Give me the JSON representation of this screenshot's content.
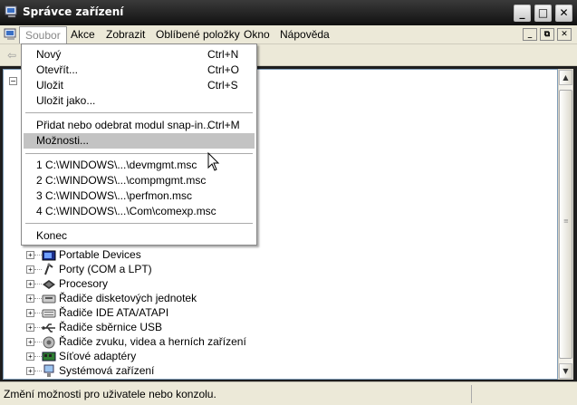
{
  "window": {
    "title": "Správce zařízení",
    "buttons": {
      "minimize": "_",
      "maximize": "□",
      "close": "✕"
    }
  },
  "menubar": {
    "items": [
      "Soubor",
      "Akce",
      "Zobrazit",
      "Oblíbené položky",
      "Okno",
      "Nápověda"
    ],
    "mdi_buttons": [
      "_",
      "⧉",
      "✕"
    ]
  },
  "toolbar": {
    "back_icon": "back-arrow-icon",
    "back_glyph": "⇦"
  },
  "file_menu": {
    "items": [
      {
        "label": "Nový",
        "shortcut": "Ctrl+N"
      },
      {
        "label": "Otevřít...",
        "shortcut": "Ctrl+O"
      },
      {
        "label": "Uložit",
        "shortcut": "Ctrl+S"
      },
      {
        "label": "Uložit jako...",
        "shortcut": ""
      },
      {
        "label": "Přidat nebo odebrat modul snap-in...",
        "shortcut": "Ctrl+M"
      },
      {
        "label": "Možnosti...",
        "shortcut": ""
      },
      {
        "label": "1 C:\\WINDOWS\\...\\devmgmt.msc",
        "shortcut": ""
      },
      {
        "label": "2 C:\\WINDOWS\\...\\compmgmt.msc",
        "shortcut": ""
      },
      {
        "label": "3 C:\\WINDOWS\\...\\perfmon.msc",
        "shortcut": ""
      },
      {
        "label": "4 C:\\WINDOWS\\...\\Com\\comexp.msc",
        "shortcut": ""
      },
      {
        "label": "Konec",
        "shortcut": ""
      }
    ],
    "highlighted": "Možnosti..."
  },
  "tree": {
    "root_toggle": "−",
    "items": [
      {
        "label": "Portable Devices",
        "icon": "portable-device-icon"
      },
      {
        "label": "Porty (COM a LPT)",
        "icon": "port-icon"
      },
      {
        "label": "Procesory",
        "icon": "processor-icon"
      },
      {
        "label": "Řadiče disketových jednotek",
        "icon": "floppy-controller-icon"
      },
      {
        "label": "Řadiče IDE ATA/ATAPI",
        "icon": "ide-controller-icon"
      },
      {
        "label": "Řadiče sběrnice USB",
        "icon": "usb-icon"
      },
      {
        "label": "Řadiče zvuku, videa a herních zařízení",
        "icon": "sound-icon"
      },
      {
        "label": "Síťové adaptéry",
        "icon": "network-adapter-icon"
      },
      {
        "label": "Systémová zařízení",
        "icon": "system-device-icon"
      }
    ],
    "expander": "+"
  },
  "statusbar": {
    "text": "Změní možnosti pro uživatele nebo konzolu."
  },
  "scrollbar": {
    "up": "▲",
    "down": "▼",
    "grip": "≡"
  }
}
